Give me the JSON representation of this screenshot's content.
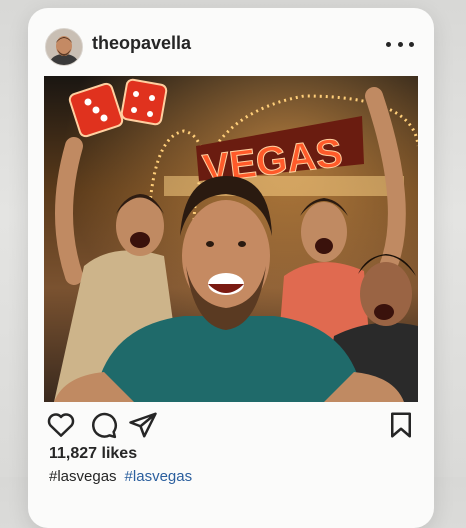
{
  "post": {
    "username": "theopavella",
    "image_sign_text": "VEGAS",
    "likes": "11,827 likes",
    "hashtags": [
      "#lasvegas",
      "#lasvegas"
    ]
  },
  "icons": {
    "more": "more-horizontal-icon",
    "like": "heart-icon",
    "comment": "comment-icon",
    "share": "send-icon",
    "save": "bookmark-icon"
  },
  "colors": {
    "card": "#fbfbfa",
    "text": "#262626",
    "hashtag_link": "#2b5f9e",
    "neon_sign": "#ff5a2a"
  }
}
